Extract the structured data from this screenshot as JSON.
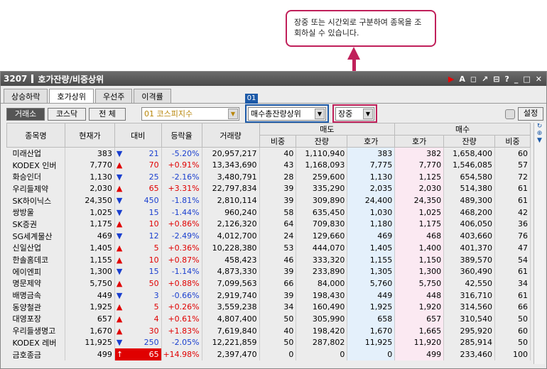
{
  "callout": {
    "text": "장중 또는 시간외로 구분하여 종목을 조회하실 수 있습니다."
  },
  "window": {
    "id": "3207",
    "title": "호가잔량/비중상위"
  },
  "tabs": [
    "상승하락",
    "호가상위",
    "우선주",
    "이격률"
  ],
  "market_buttons": [
    "거래소",
    "코스닥",
    "전  체"
  ],
  "badge": "01",
  "index_combo": "01  코스피지수",
  "sort_combo": "매수총잔량상위",
  "session_combo": "장중",
  "settings_label": "설정",
  "headers": {
    "name": "종목명",
    "price": "현재가",
    "change": "대비",
    "rate": "등락율",
    "volume": "거래량",
    "sell": "매도",
    "buy": "매수",
    "ratio": "비중",
    "qty": "잔량",
    "quote": "호가"
  },
  "rows": [
    {
      "name": "미래산업",
      "price": "383",
      "dir": "down",
      "change": "21",
      "rate": "-5.20%",
      "volume": "20,957,217",
      "s_ratio": "40",
      "s_qty": "1,110,940",
      "s_quote": "383",
      "b_quote": "382",
      "b_qty": "1,658,400",
      "b_ratio": "60"
    },
    {
      "name": "KODEX 인버",
      "price": "7,770",
      "dir": "up",
      "change": "70",
      "rate": "+0.91%",
      "volume": "13,343,690",
      "s_ratio": "43",
      "s_qty": "1,168,093",
      "s_quote": "7,775",
      "b_quote": "7,770",
      "b_qty": "1,546,085",
      "b_ratio": "57"
    },
    {
      "name": "화승인더",
      "price": "1,130",
      "dir": "down",
      "change": "25",
      "rate": "-2.16%",
      "volume": "3,480,791",
      "s_ratio": "28",
      "s_qty": "259,600",
      "s_quote": "1,130",
      "b_quote": "1,125",
      "b_qty": "654,580",
      "b_ratio": "72"
    },
    {
      "name": "우리들제약",
      "price": "2,030",
      "dir": "up",
      "change": "65",
      "rate": "+3.31%",
      "volume": "22,797,834",
      "s_ratio": "39",
      "s_qty": "335,290",
      "s_quote": "2,035",
      "b_quote": "2,030",
      "b_qty": "514,380",
      "b_ratio": "61"
    },
    {
      "name": "SK하이닉스",
      "price": "24,350",
      "dir": "down",
      "change": "450",
      "rate": "-1.81%",
      "volume": "2,810,114",
      "s_ratio": "39",
      "s_qty": "309,890",
      "s_quote": "24,400",
      "b_quote": "24,350",
      "b_qty": "489,300",
      "b_ratio": "61"
    },
    {
      "name": "쌍방울",
      "price": "1,025",
      "dir": "down",
      "change": "15",
      "rate": "-1.44%",
      "volume": "960,240",
      "s_ratio": "58",
      "s_qty": "635,450",
      "s_quote": "1,030",
      "b_quote": "1,025",
      "b_qty": "468,200",
      "b_ratio": "42"
    },
    {
      "name": "SK증권",
      "price": "1,175",
      "dir": "up",
      "change": "10",
      "rate": "+0.86%",
      "volume": "2,126,320",
      "s_ratio": "64",
      "s_qty": "709,830",
      "s_quote": "1,180",
      "b_quote": "1,175",
      "b_qty": "406,050",
      "b_ratio": "36"
    },
    {
      "name": "SG세계물산",
      "price": "469",
      "dir": "down",
      "change": "12",
      "rate": "-2.49%",
      "volume": "4,012,700",
      "s_ratio": "24",
      "s_qty": "129,660",
      "s_quote": "469",
      "b_quote": "468",
      "b_qty": "403,660",
      "b_ratio": "76"
    },
    {
      "name": "신일산업",
      "price": "1,405",
      "dir": "up",
      "change": "5",
      "rate": "+0.36%",
      "volume": "10,228,380",
      "s_ratio": "53",
      "s_qty": "444,070",
      "s_quote": "1,405",
      "b_quote": "1,400",
      "b_qty": "401,370",
      "b_ratio": "47"
    },
    {
      "name": "한솔홈데코",
      "price": "1,155",
      "dir": "up",
      "change": "10",
      "rate": "+0.87%",
      "volume": "458,423",
      "s_ratio": "46",
      "s_qty": "333,320",
      "s_quote": "1,155",
      "b_quote": "1,150",
      "b_qty": "389,570",
      "b_ratio": "54"
    },
    {
      "name": "에이엔피",
      "price": "1,300",
      "dir": "down",
      "change": "15",
      "rate": "-1.14%",
      "volume": "4,873,330",
      "s_ratio": "39",
      "s_qty": "233,890",
      "s_quote": "1,305",
      "b_quote": "1,300",
      "b_qty": "360,490",
      "b_ratio": "61"
    },
    {
      "name": "명문제약",
      "price": "5,750",
      "dir": "up",
      "change": "50",
      "rate": "+0.88%",
      "volume": "7,099,563",
      "s_ratio": "66",
      "s_qty": "84,000",
      "s_quote": "5,760",
      "b_quote": "5,750",
      "b_qty": "42,550",
      "b_ratio": "34"
    },
    {
      "name": "배명금속",
      "price": "449",
      "dir": "down",
      "change": "3",
      "rate": "-0.66%",
      "volume": "2,919,740",
      "s_ratio": "39",
      "s_qty": "198,430",
      "s_quote": "449",
      "b_quote": "448",
      "b_qty": "316,710",
      "b_ratio": "61"
    },
    {
      "name": "동양철관",
      "price": "1,925",
      "dir": "up",
      "change": "5",
      "rate": "+0.26%",
      "volume": "3,559,238",
      "s_ratio": "34",
      "s_qty": "160,490",
      "s_quote": "1,925",
      "b_quote": "1,920",
      "b_qty": "314,560",
      "b_ratio": "66"
    },
    {
      "name": "대영포장",
      "price": "657",
      "dir": "up",
      "change": "4",
      "rate": "+0.61%",
      "volume": "4,807,400",
      "s_ratio": "50",
      "s_qty": "305,990",
      "s_quote": "658",
      "b_quote": "657",
      "b_qty": "310,540",
      "b_ratio": "50"
    },
    {
      "name": "우리들생명고",
      "price": "1,670",
      "dir": "up",
      "change": "30",
      "rate": "+1.83%",
      "volume": "7,619,840",
      "s_ratio": "40",
      "s_qty": "198,420",
      "s_quote": "1,670",
      "b_quote": "1,665",
      "b_qty": "295,920",
      "b_ratio": "60"
    },
    {
      "name": "KODEX 레버",
      "price": "11,925",
      "dir": "down",
      "change": "250",
      "rate": "-2.05%",
      "volume": "12,221,859",
      "s_ratio": "50",
      "s_qty": "287,802",
      "s_quote": "11,925",
      "b_quote": "11,920",
      "b_qty": "285,914",
      "b_ratio": "50"
    },
    {
      "name": "금호종금",
      "price": "499",
      "dir": "limit",
      "change": "65",
      "rate": "+14.98%",
      "volume": "2,397,470",
      "s_ratio": "0",
      "s_qty": "0",
      "s_quote": "0",
      "b_quote": "499",
      "b_qty": "233,460",
      "b_ratio": "100"
    }
  ],
  "colors": {
    "up": "#e00000",
    "down": "#1a3fcf",
    "callout_border": "#c0205a"
  }
}
